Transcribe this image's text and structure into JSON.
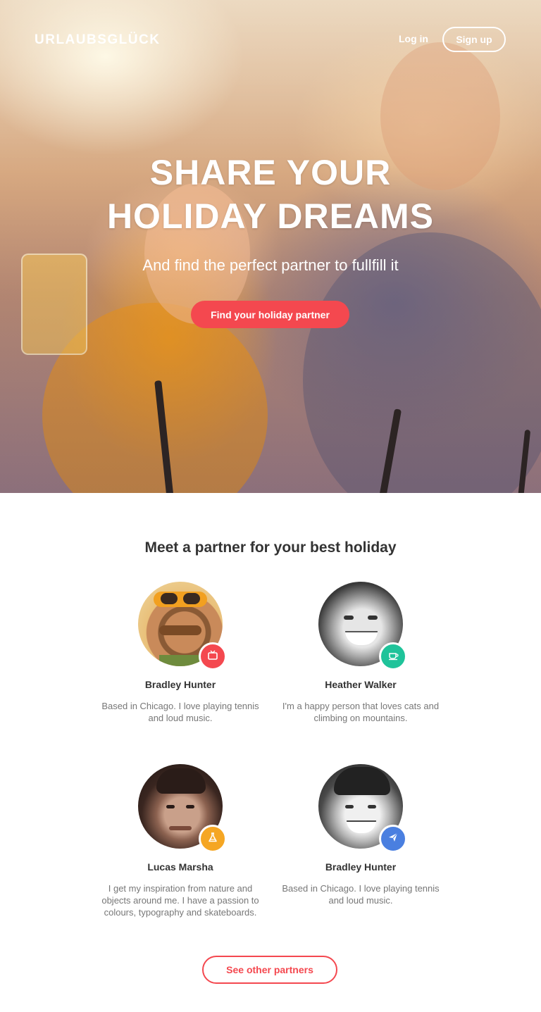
{
  "header": {
    "brand": "URLAUBSGLÜCK",
    "login_label": "Log in",
    "signup_label": "Sign up"
  },
  "hero": {
    "headline_line1": "SHARE YOUR",
    "headline_line2": "HOLIDAY DREAMS",
    "subline": "And find the perfect partner to fullfill it",
    "cta_label": "Find your holiday partner"
  },
  "partners": {
    "title": "Meet a partner for your best holiday",
    "items": [
      {
        "name": "Bradley Hunter",
        "description": "Based in Chicago. I love playing tennis and loud music.",
        "badge_icon": "tv-icon",
        "badge_color": "#f4484f"
      },
      {
        "name": "Heather Walker",
        "description": "I'm a happy person that loves cats and climbing on mountains.",
        "badge_icon": "coffee-icon",
        "badge_color": "#1fc39a"
      },
      {
        "name": "Lucas Marsha",
        "description": "I get my inspiration from nature and objects around me. I have a passion to colours, typography and skateboards.",
        "badge_icon": "flask-icon",
        "badge_color": "#f5a623"
      },
      {
        "name": "Bradley Hunter",
        "description": "Based in Chicago. I love playing tennis and loud music.",
        "badge_icon": "paper-plane-icon",
        "badge_color": "#4a7fe0"
      }
    ],
    "see_more_label": "See other partners"
  },
  "colors": {
    "accent": "#f4484f",
    "text": "#333333",
    "muted": "#777777"
  }
}
